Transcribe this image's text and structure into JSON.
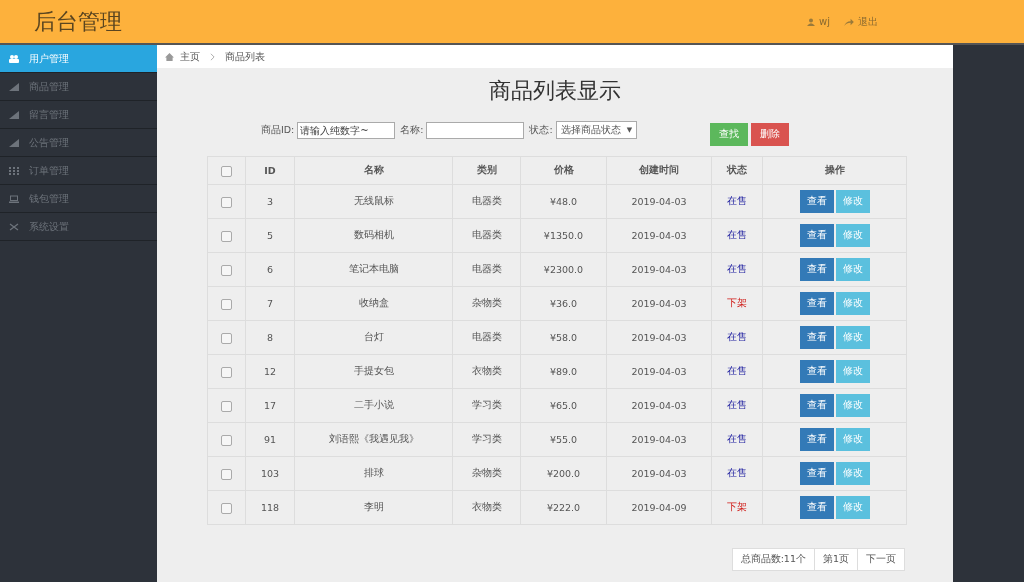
{
  "header": {
    "title": "后台管理",
    "user": "wj",
    "logout": "退出"
  },
  "sidebar": {
    "items": [
      {
        "label": "用户管理",
        "selected": true
      },
      {
        "label": "商品管理",
        "selected": false
      },
      {
        "label": "留言管理",
        "selected": false
      },
      {
        "label": "公告管理",
        "selected": false
      },
      {
        "label": "订单管理",
        "selected": false
      },
      {
        "label": "钱包管理",
        "selected": false
      },
      {
        "label": "系统设置",
        "selected": false
      }
    ]
  },
  "breadcrumb": [
    "主页",
    "商品列表"
  ],
  "page_title": "商品列表显示",
  "filters": {
    "id_label": "商品ID:",
    "id_placeholder": "请输入纯数字~",
    "name_label": "名称:",
    "status_label": "状态:",
    "status_value": "选择商品状态",
    "status_arrow": "▼",
    "search_button": "查找",
    "delete_button": "删除"
  },
  "table": {
    "select_all_checked": false,
    "columns": [
      "ID",
      "名称",
      "类别",
      "价格",
      "创建时间",
      "状态",
      "操作"
    ],
    "rows": [
      {
        "checked": false,
        "id": "3",
        "name": "无线鼠标",
        "category": "电器类",
        "price": "¥48.0",
        "created": "2019-04-03",
        "status": "在售",
        "on_sale": true,
        "view": "查看",
        "edit": "修改"
      },
      {
        "checked": false,
        "id": "5",
        "name": "数码相机",
        "category": "电器类",
        "price": "¥1350.0",
        "created": "2019-04-03",
        "status": "在售",
        "on_sale": true,
        "view": "查看",
        "edit": "修改"
      },
      {
        "checked": false,
        "id": "6",
        "name": "笔记本电脑",
        "category": "电器类",
        "price": "¥2300.0",
        "created": "2019-04-03",
        "status": "在售",
        "on_sale": true,
        "view": "查看",
        "edit": "修改"
      },
      {
        "checked": false,
        "id": "7",
        "name": "收纳盒",
        "category": "杂物类",
        "price": "¥36.0",
        "created": "2019-04-03",
        "status": "下架",
        "on_sale": false,
        "view": "查看",
        "edit": "修改"
      },
      {
        "checked": false,
        "id": "8",
        "name": "台灯",
        "category": "电器类",
        "price": "¥58.0",
        "created": "2019-04-03",
        "status": "在售",
        "on_sale": true,
        "view": "查看",
        "edit": "修改"
      },
      {
        "checked": false,
        "id": "12",
        "name": "手提女包",
        "category": "衣物类",
        "price": "¥89.0",
        "created": "2019-04-03",
        "status": "在售",
        "on_sale": true,
        "view": "查看",
        "edit": "修改"
      },
      {
        "checked": false,
        "id": "17",
        "name": "二手小说",
        "category": "学习类",
        "price": "¥65.0",
        "created": "2019-04-03",
        "status": "在售",
        "on_sale": true,
        "view": "查看",
        "edit": "修改"
      },
      {
        "checked": false,
        "id": "91",
        "name": "刘语熙《我遇见我》",
        "category": "学习类",
        "price": "¥55.0",
        "created": "2019-04-03",
        "status": "在售",
        "on_sale": true,
        "view": "查看",
        "edit": "修改"
      },
      {
        "checked": false,
        "id": "103",
        "name": "排球",
        "category": "杂物类",
        "price": "¥200.0",
        "created": "2019-04-03",
        "status": "在售",
        "on_sale": true,
        "view": "查看",
        "edit": "修改"
      },
      {
        "checked": false,
        "id": "118",
        "name": "李明",
        "category": "衣物类",
        "price": "¥222.0",
        "created": "2019-04-09",
        "status": "下架",
        "on_sale": false,
        "view": "查看",
        "edit": "修改"
      }
    ]
  },
  "pagination": [
    "总商品数:11个",
    "第1页",
    "下一页"
  ]
}
